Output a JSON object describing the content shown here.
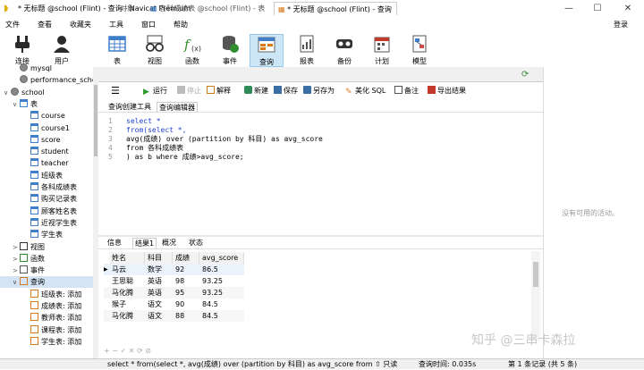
{
  "window": {
    "title": "* 无标题 @school (Flint) - 查询 - Navicat Premium",
    "login": "登录",
    "min": "—",
    "max": "☐",
    "close": "✕"
  },
  "menu": [
    "文件",
    "查看",
    "收藏夹",
    "工具",
    "窗口",
    "帮助"
  ],
  "toolbar": [
    {
      "label": "连接",
      "icon": "plug-icon",
      "color": "#2a2a2a"
    },
    {
      "label": "用户",
      "icon": "user-icon",
      "color": "#333333"
    },
    {
      "label": "表",
      "icon": "table-icon",
      "color": "#3f7fc9"
    },
    {
      "label": "视图",
      "icon": "glasses-icon",
      "color": "#444444"
    },
    {
      "label": "函数",
      "icon": "function-icon",
      "color": "#2f8f2f"
    },
    {
      "label": "事件",
      "icon": "event-icon",
      "color": "#2f8f2f"
    },
    {
      "label": "查询",
      "icon": "query-icon",
      "color": "#d97a1d"
    },
    {
      "label": "报表",
      "icon": "report-icon",
      "color": "#555555"
    },
    {
      "label": "备份",
      "icon": "backup-icon",
      "color": "#333333"
    },
    {
      "label": "计划",
      "icon": "schedule-icon",
      "color": "#c0392b"
    },
    {
      "label": "模型",
      "icon": "model-icon",
      "color": "#d24a4a"
    }
  ],
  "tree": {
    "items": [
      {
        "label": "mysql",
        "level": 2,
        "icon": "database-icon"
      },
      {
        "label": "performance_sche",
        "level": 2,
        "icon": "database-icon"
      },
      {
        "label": "school",
        "level": 1,
        "icon": "database-icon",
        "toggle": "∨"
      },
      {
        "label": "表",
        "level": 2,
        "icon": "tables-icon",
        "toggle": "∨"
      },
      {
        "label": "course",
        "level": 3,
        "icon": "table-icon"
      },
      {
        "label": "course1",
        "level": 3,
        "icon": "table-icon"
      },
      {
        "label": "score",
        "level": 3,
        "icon": "table-icon"
      },
      {
        "label": "student",
        "level": 3,
        "icon": "table-icon"
      },
      {
        "label": "teacher",
        "level": 3,
        "icon": "table-icon"
      },
      {
        "label": "班级表",
        "level": 3,
        "icon": "table-icon"
      },
      {
        "label": "各科成绩表",
        "level": 3,
        "icon": "table-icon"
      },
      {
        "label": "购买记录表",
        "level": 3,
        "icon": "table-icon"
      },
      {
        "label": "顾客姓名表",
        "level": 3,
        "icon": "table-icon"
      },
      {
        "label": "近视学生表",
        "level": 3,
        "icon": "table-icon"
      },
      {
        "label": "学生表",
        "level": 3,
        "icon": "table-icon"
      },
      {
        "label": "视图",
        "level": 2,
        "icon": "view-icon",
        "toggle": ">"
      },
      {
        "label": "函数",
        "level": 2,
        "icon": "function-icon",
        "toggle": ">"
      },
      {
        "label": "事件",
        "level": 2,
        "icon": "event-icon",
        "toggle": ">"
      },
      {
        "label": "查询",
        "level": 2,
        "icon": "query-icon",
        "toggle": "∨",
        "selected": true
      },
      {
        "label": "班级表: 添加",
        "level": 3,
        "icon": "query-icon"
      },
      {
        "label": "成绩表: 添加",
        "level": 3,
        "icon": "query-icon"
      },
      {
        "label": "教师表: 添加",
        "level": 3,
        "icon": "query-icon"
      },
      {
        "label": "课程表: 添加",
        "level": 3,
        "icon": "query-icon"
      },
      {
        "label": "学生表: 添加",
        "level": 3,
        "icon": "query-icon"
      }
    ]
  },
  "tabs": [
    {
      "label": "对象",
      "active": false
    },
    {
      "label": "各科成绩表 @school (Flint) - 表",
      "active": false
    },
    {
      "label": "* 无标题 @school (Flint) - 查询",
      "active": true
    }
  ],
  "query_toolbar": [
    {
      "label": "运行",
      "icon": "play-icon",
      "color": "#2e9d2e"
    },
    {
      "label": "停止",
      "icon": "stop-icon",
      "color": "#bbbbbb"
    },
    {
      "label": "解释",
      "icon": "explain-icon",
      "color": "#c77b1a"
    },
    {
      "label": "新建",
      "icon": "new-icon",
      "color": "#2e8b57"
    },
    {
      "label": "保存",
      "icon": "save-icon",
      "color": "#3a6ea5"
    },
    {
      "label": "另存为",
      "icon": "saveas-icon",
      "color": "#3a6ea5"
    },
    {
      "label": "美化 SQL",
      "icon": "beautify-icon",
      "color": "#d9822b"
    },
    {
      "label": "备注",
      "icon": "note-icon",
      "color": "#555555"
    },
    {
      "label": "导出结果",
      "icon": "export-icon",
      "color": "#c0392b"
    }
  ],
  "editor_tabs": [
    "查询创建工具",
    "查询编辑器"
  ],
  "editor": {
    "line_numbers": [
      "1",
      "2",
      "3",
      "4",
      "5"
    ],
    "lines": [
      "select *",
      "from(select *,",
      "avg(成绩) over (partition by 科目) as avg_score",
      "from 各科成绩表",
      ") as b where 成绩>avg_score;"
    ]
  },
  "result_tabs": [
    "信息",
    "结果1",
    "概况",
    "状态"
  ],
  "result": {
    "columns": [
      "姓名",
      "科目",
      "成绩",
      "avg_score"
    ],
    "rows": [
      [
        "马云",
        "数学",
        "92",
        "86.5"
      ],
      [
        "王思聪",
        "英语",
        "98",
        "93.25"
      ],
      [
        "马化腾",
        "英语",
        "95",
        "93.25"
      ],
      [
        "猴子",
        "语文",
        "90",
        "84.5"
      ],
      [
        "马化腾",
        "语文",
        "88",
        "84.5"
      ]
    ],
    "row_marker": "▶"
  },
  "grid_nav": "+ − ✓ ✕ ⟳ ⊘",
  "right_pane": {
    "text": "没有可用的活动。"
  },
  "status": {
    "sql": "select * from(select *, avg(成绩) over (partition by 科目) as avg_score from ⇧ 只读",
    "time": "查询时间: 0.035s",
    "record": "第 1 条记录 (共 5 条)"
  },
  "watermark": "知乎 @三串卡森拉"
}
